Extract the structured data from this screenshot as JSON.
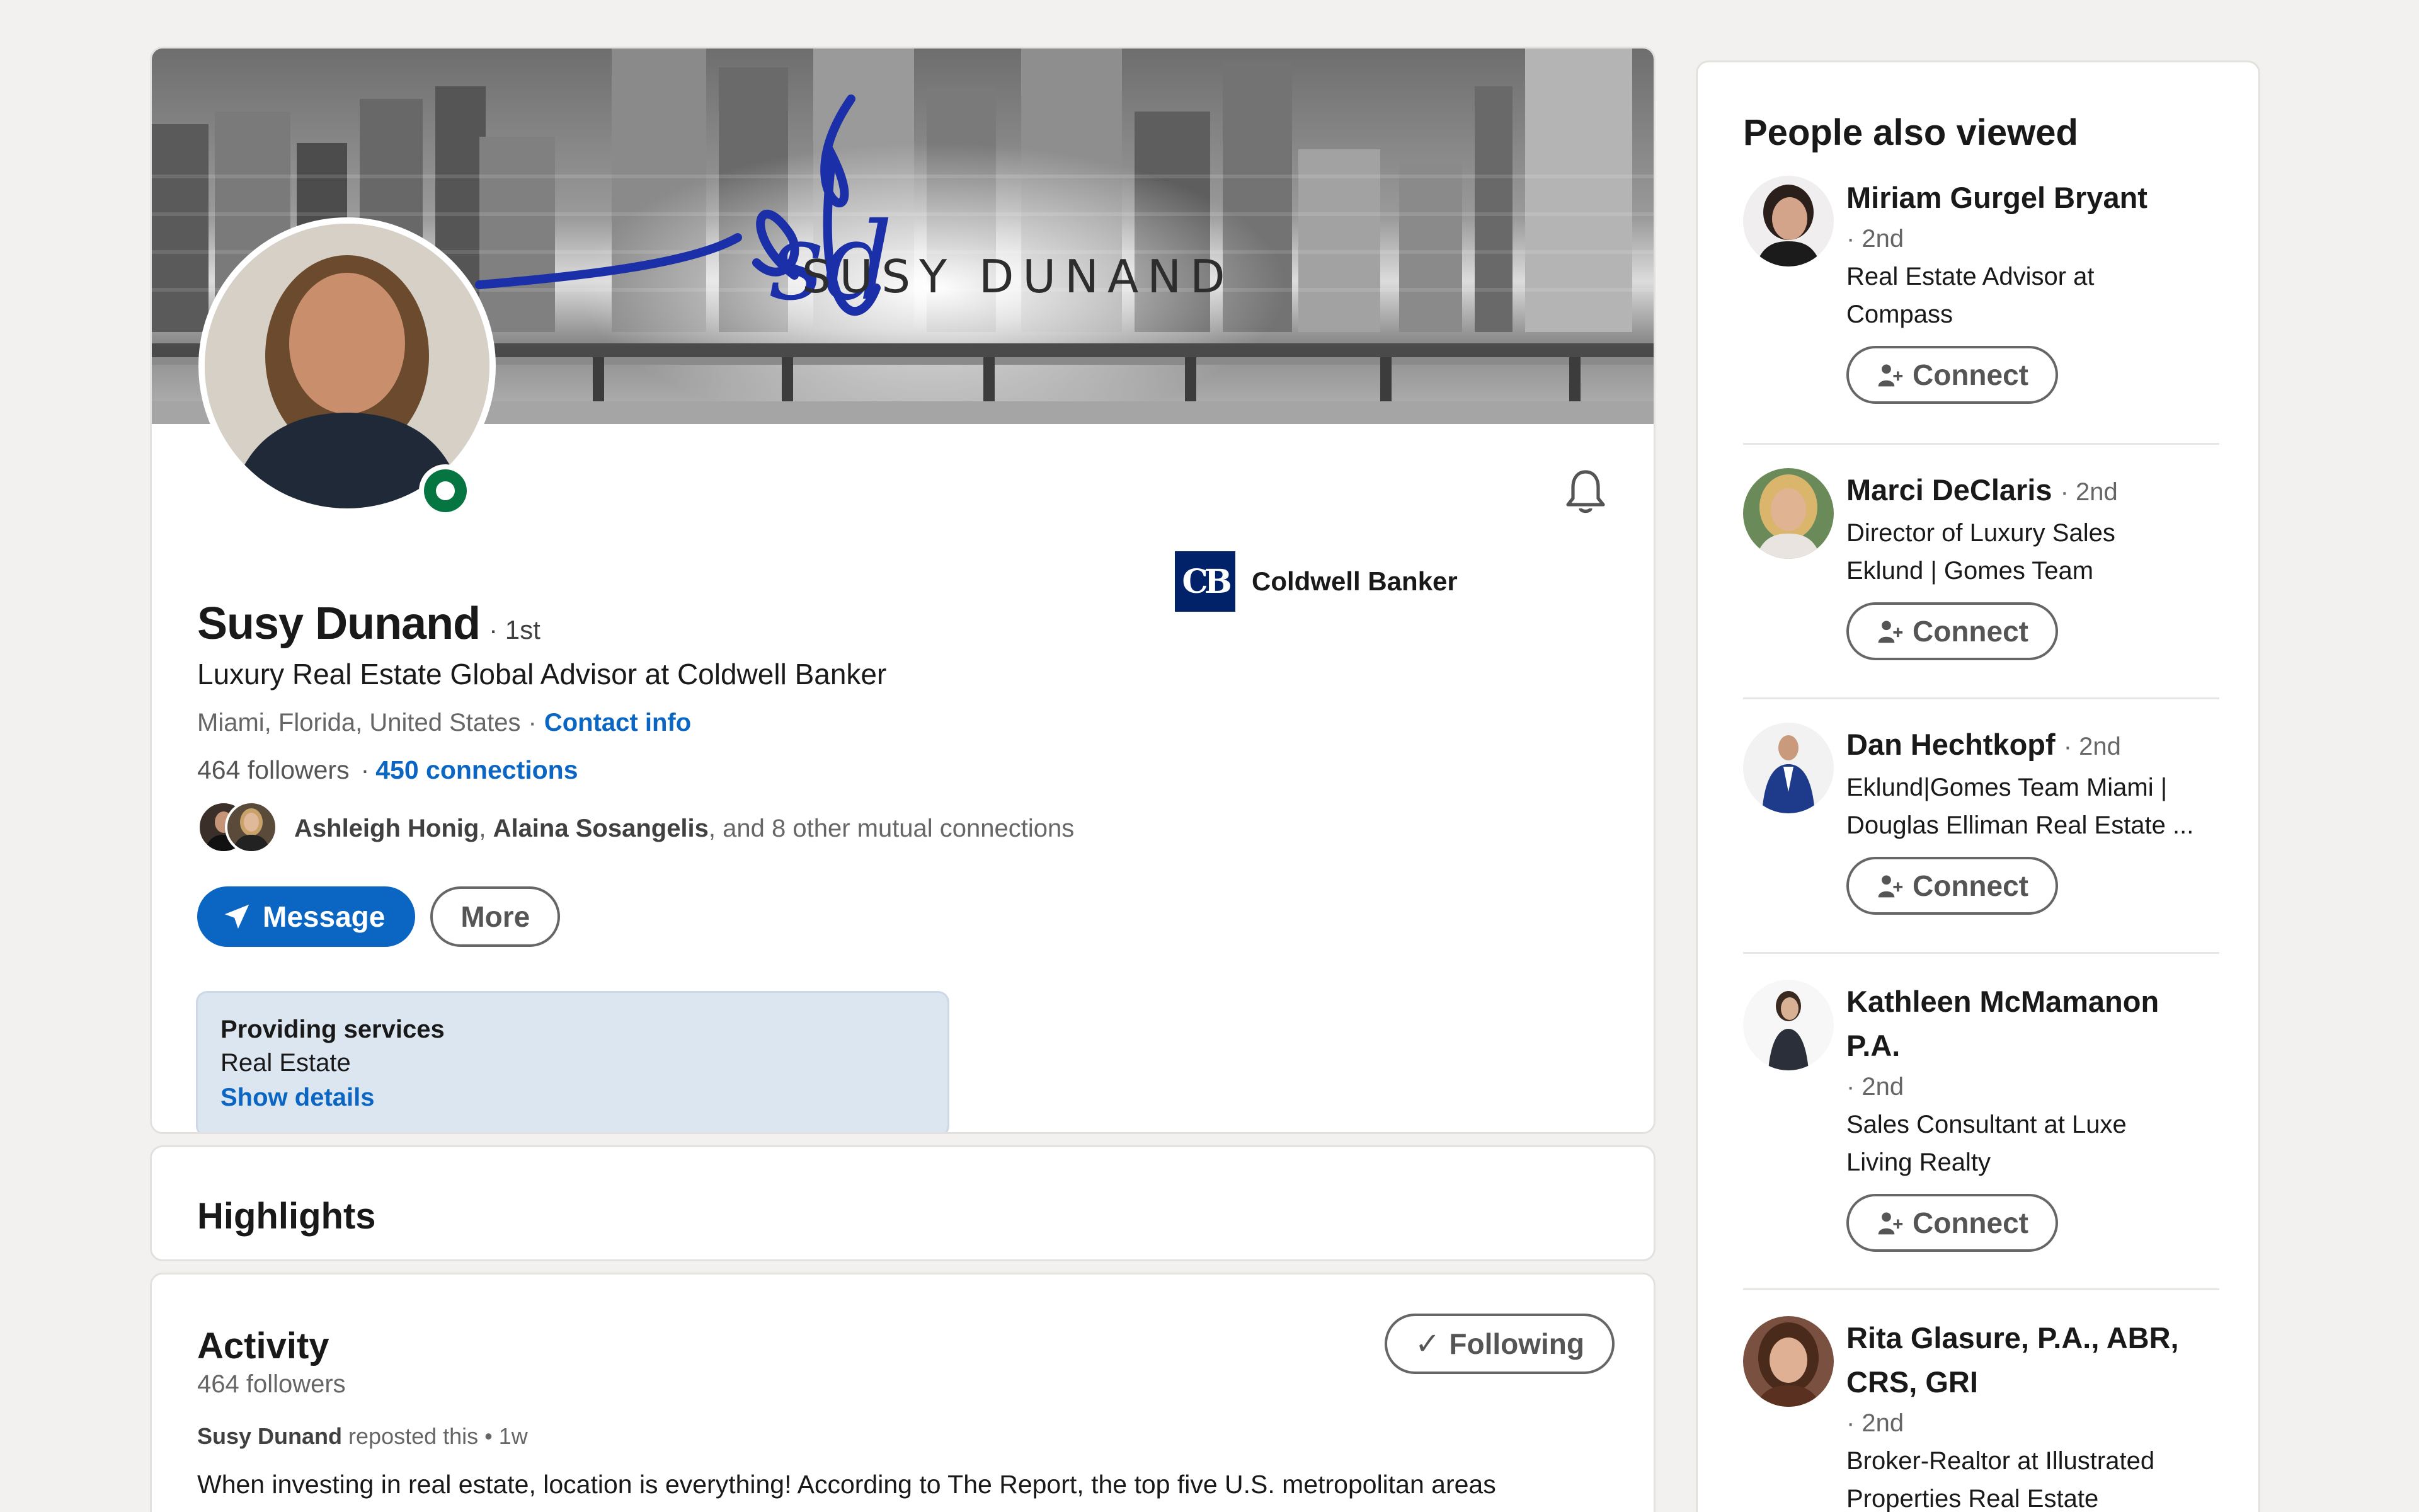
{
  "profile": {
    "banner_text": "SUSY DUNAND",
    "banner_script": "sd",
    "name": "Susy Dunand",
    "degree": "· 1st",
    "headline": "Luxury Real Estate Global Advisor at Coldwell Banker",
    "location": "Miami, Florida, United States",
    "location_sep": "·",
    "contact_info": "Contact info",
    "followers": "464 followers",
    "connections_sep": "·",
    "connections": "450 connections",
    "mutual_names_1": "Ashleigh Honig",
    "mutual_sep": ", ",
    "mutual_names_2": "Alaina Sosangelis",
    "mutual_rest": ", and 8 other mutual connections",
    "message_label": "Message",
    "more_label": "More",
    "company_name": "Coldwell Banker",
    "company_logo_text": "CB",
    "services_title": "Providing services",
    "services_value": "Real Estate",
    "services_link": "Show details"
  },
  "highlights": {
    "title": "Highlights"
  },
  "activity": {
    "title": "Activity",
    "followers": "464 followers",
    "following_label": "Following",
    "repost_author": "Susy Dunand",
    "repost_text": " reposted this • 1w",
    "post_text": "When investing in real estate, location is everything! According to The Report, the top five U.S. metropolitan areas"
  },
  "sidebar": {
    "title": "People also viewed",
    "connect_label": "Connect",
    "people": [
      {
        "name": "Miriam Gurgel Bryant",
        "degree": "· 2nd",
        "title_lines": [
          "Real Estate Advisor at",
          "Compass"
        ]
      },
      {
        "name": "Marci DeClaris",
        "degree": "· 2nd",
        "title_lines": [
          "Director of Luxury Sales",
          "Eklund | Gomes Team"
        ]
      },
      {
        "name": "Dan Hechtkopf",
        "degree": "· 2nd",
        "title_lines": [
          "Eklund|Gomes Team Miami |",
          "Douglas Elliman Real Estate ..."
        ]
      },
      {
        "name": "Kathleen McMamanon P.A.",
        "degree": "· 2nd",
        "title_lines": [
          "Sales Consultant at Luxe",
          "Living Realty"
        ]
      },
      {
        "name": "Rita Glasure, P.A., ABR, CRS, GRI",
        "degree": "· 2nd",
        "title_lines": [
          "Broker-Realtor at Illustrated",
          "Properties Real Estate"
        ]
      }
    ]
  },
  "colors": {
    "accent": "#0a66c2",
    "online": "#057642",
    "background": "#f3f1ef",
    "banner_ink": "#1b2fa8",
    "company_brand": "#012169"
  }
}
